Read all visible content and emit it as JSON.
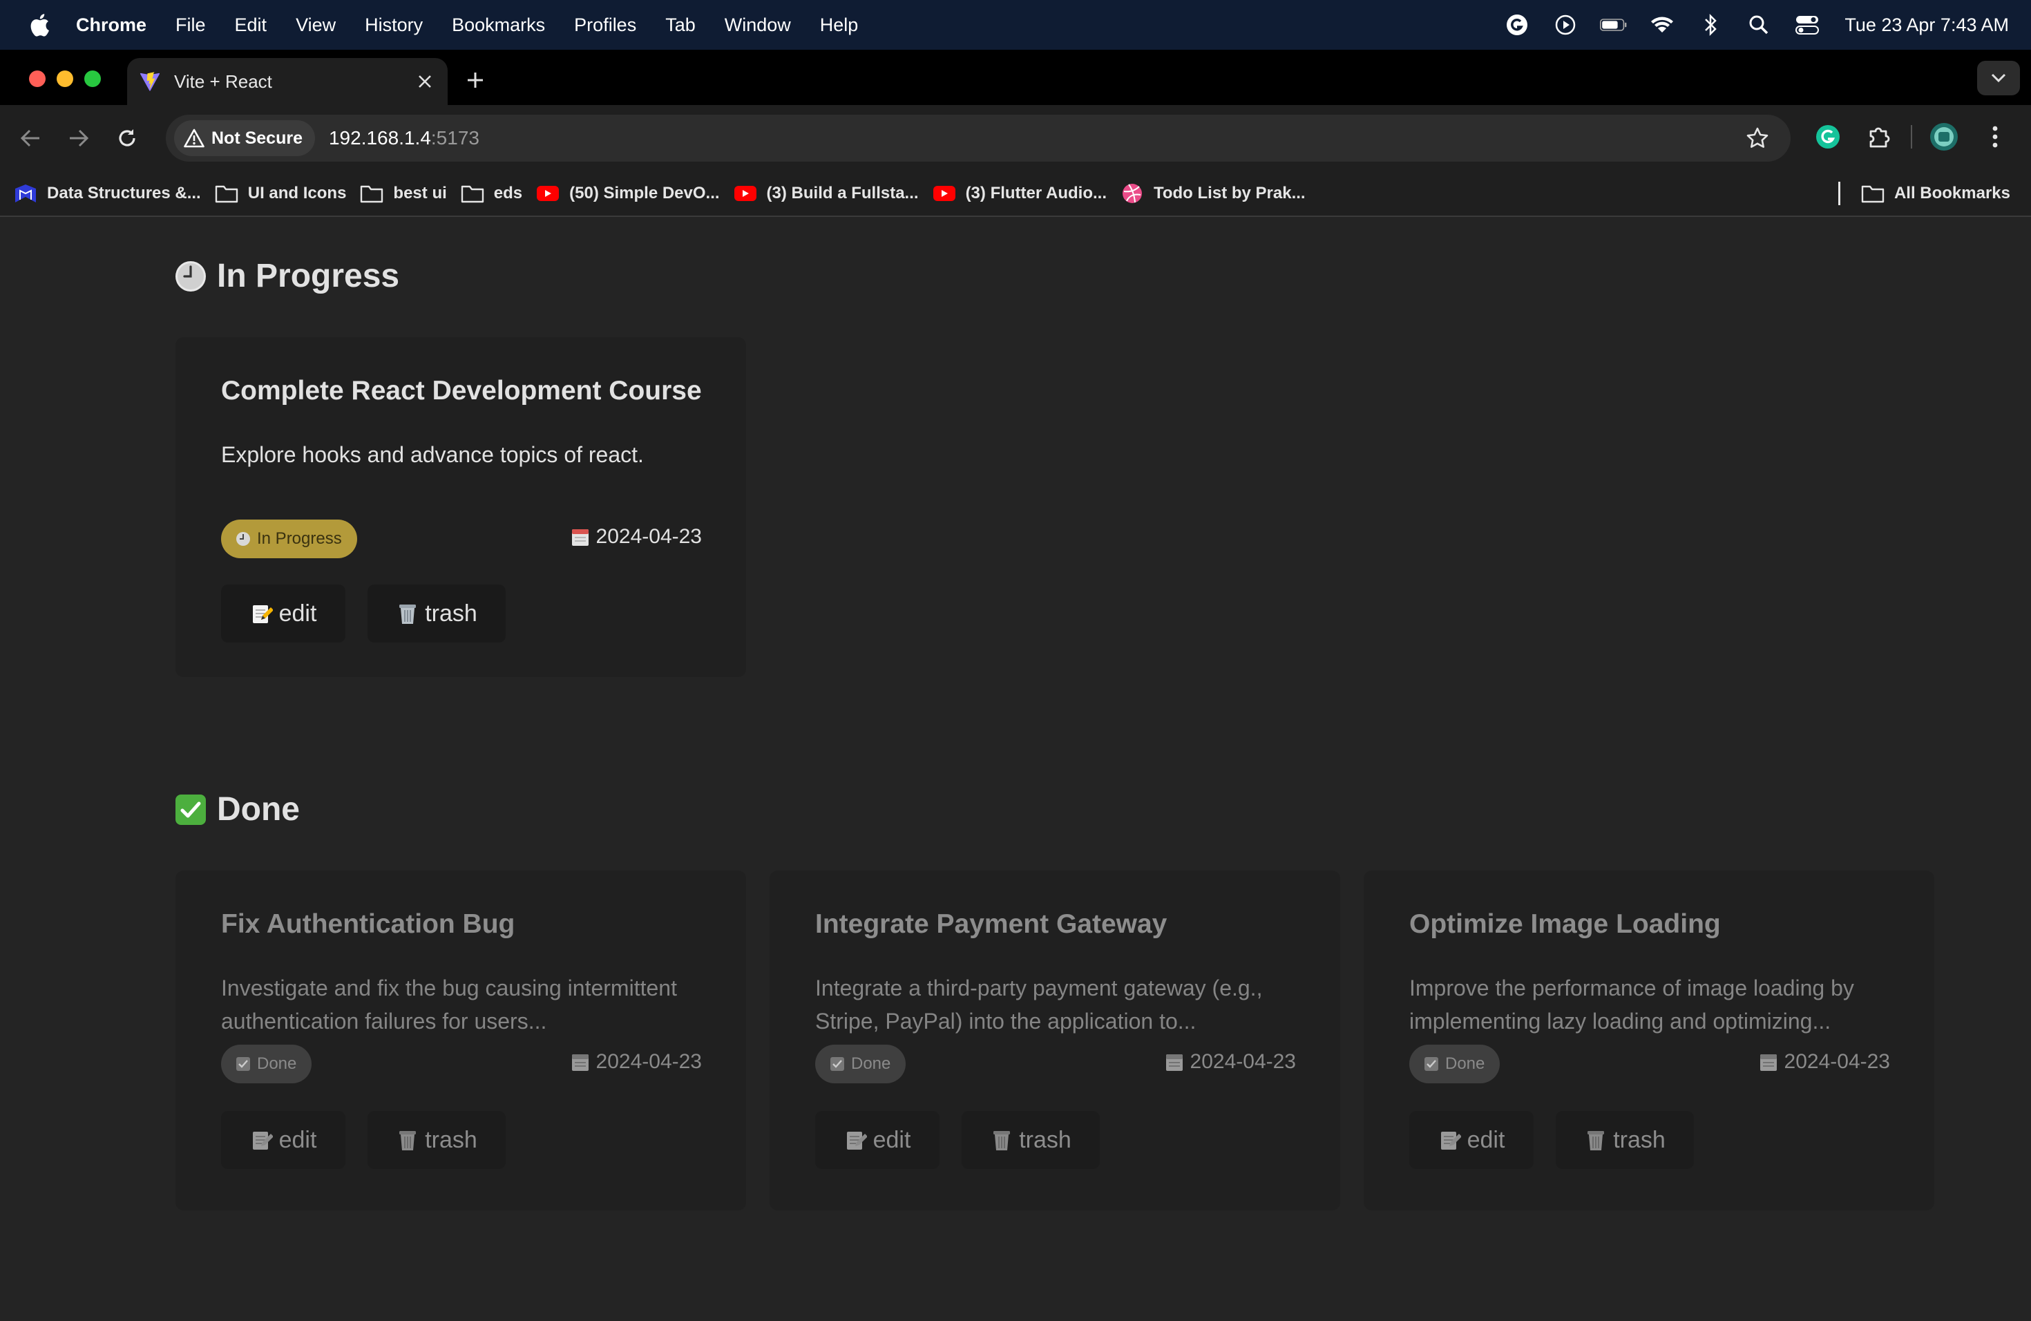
{
  "menubar": {
    "app_name": "Chrome",
    "items": [
      "File",
      "Edit",
      "View",
      "History",
      "Bookmarks",
      "Profiles",
      "Tab",
      "Window",
      "Help"
    ],
    "clock": "Tue 23 Apr  7:43 AM"
  },
  "browser": {
    "tab_title": "Vite + React",
    "security_label": "Not Secure",
    "url_host": "192.168.1.4",
    "url_port": ":5173"
  },
  "bookmarks": {
    "items": [
      "Data Structures &...",
      "UI and Icons",
      "best ui",
      "eds",
      "(50) Simple DevO...",
      "(3) Build a Fullsta...",
      "(3) Flutter Audio...",
      "Todo List by Prak..."
    ],
    "all_label": "All Bookmarks"
  },
  "sections": {
    "in_progress": {
      "title": "In Progress",
      "cards": [
        {
          "title": "Complete React Development Course",
          "description": "Explore hooks and advance topics of react.",
          "status": "In Progress",
          "date": "2024-04-23",
          "edit_label": "edit",
          "trash_label": "trash"
        }
      ]
    },
    "done": {
      "title": "Done",
      "cards": [
        {
          "title": "Fix Authentication Bug",
          "description": "Investigate and fix the bug causing intermittent authentication failures for users...",
          "status": "Done",
          "date": "2024-04-23",
          "edit_label": "edit",
          "trash_label": "trash"
        },
        {
          "title": "Integrate Payment Gateway",
          "description": "Integrate a third-party payment gateway (e.g., Stripe, PayPal) into the application to...",
          "status": "Done",
          "date": "2024-04-23",
          "edit_label": "edit",
          "trash_label": "trash"
        },
        {
          "title": "Optimize Image Loading",
          "description": "Improve the performance of image loading by implementing lazy loading and optimizing...",
          "status": "Done",
          "date": "2024-04-23",
          "edit_label": "edit",
          "trash_label": "trash"
        }
      ]
    }
  },
  "colors": {
    "page_bg": "#242424",
    "card_bg": "#202020",
    "in_progress_badge": "#b39a3a",
    "done_badge": "#3f3f3f"
  }
}
